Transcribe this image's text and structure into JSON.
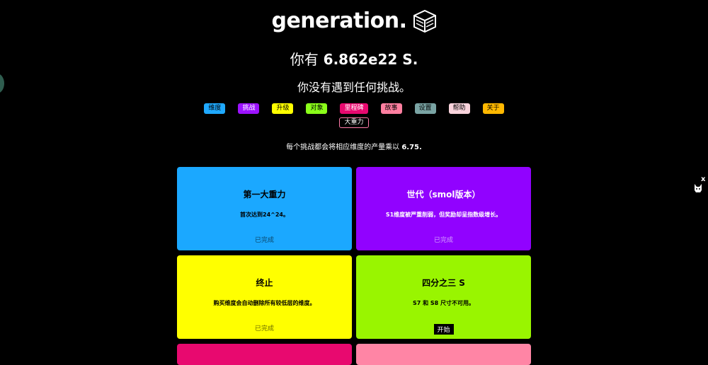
{
  "app": {
    "logo_text": "generation."
  },
  "currency": {
    "prefix": "你有",
    "amount": "6.862e22 S."
  },
  "challenge_status": "你没有遇到任何挑战。",
  "nav": {
    "tabs": [
      {
        "label": "维度",
        "color": "#1fa9ff"
      },
      {
        "label": "挑战",
        "color": "#9c12ff"
      },
      {
        "label": "升级",
        "color": "#ffff00"
      },
      {
        "label": "对象",
        "color": "#8bff1a"
      },
      {
        "label": "里程碑",
        "color": "#e8096f"
      },
      {
        "label": "故事",
        "color": "#ff7fa0"
      },
      {
        "label": "设置",
        "color": "#7aa4a4"
      },
      {
        "label": "帮助",
        "color": "#f9d3dc"
      },
      {
        "label": "关于",
        "color": "#ffb800"
      }
    ],
    "extra_tab": {
      "label": "大重力"
    }
  },
  "info": {
    "text": "每个挑战都会将相应维度的产量乘以",
    "value": "6.75."
  },
  "challenges": [
    {
      "title": "第一大重力",
      "desc": "首次达到24^24。",
      "status": "已完成",
      "color": "#1ba8ff"
    },
    {
      "title": "世代（smol版本）",
      "desc": "S1维度被严重削弱，但奖励却呈指数级增长。",
      "status": "已完成",
      "color": "#9102ff"
    },
    {
      "title": "终止",
      "desc": "购买维度会自动删除所有较低层的维度。",
      "status": "已完成",
      "color": "#ffff00"
    },
    {
      "title": "四分之三 S",
      "desc": "S7 和 S8 尺寸不可用。",
      "button": "开始",
      "color": "#99f500"
    }
  ],
  "partial_cards": [
    {
      "color": "#e8096f"
    },
    {
      "color": "#ff85a5"
    }
  ],
  "overlay": {
    "close": "x"
  }
}
